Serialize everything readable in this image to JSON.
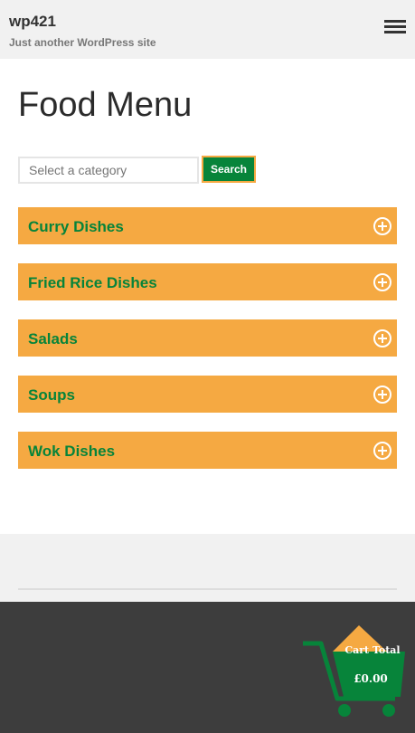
{
  "header": {
    "site_title": "wp421",
    "site_description": "Just another WordPress site"
  },
  "main": {
    "page_title": "Food Menu",
    "search": {
      "placeholder": "Select a category",
      "button_label": "Search"
    },
    "categories": [
      {
        "label": "Curry Dishes"
      },
      {
        "label": "Fried Rice Dishes"
      },
      {
        "label": "Salads"
      },
      {
        "label": "Soups"
      },
      {
        "label": "Wok Dishes"
      }
    ]
  },
  "cart": {
    "label": "Cart Total",
    "total": "£0.00"
  },
  "colors": {
    "accent_orange": "#f5a942",
    "accent_green": "#07843a",
    "footer_dark": "#3d3d3d"
  }
}
